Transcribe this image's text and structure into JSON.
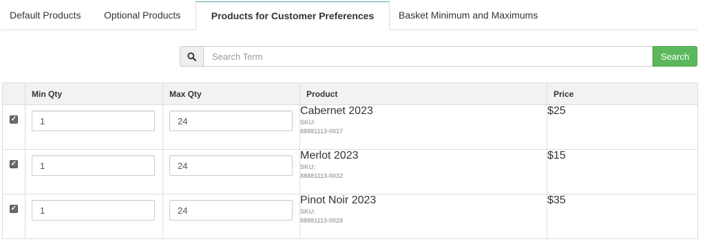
{
  "tabs": [
    {
      "label": "Default Products",
      "active": false
    },
    {
      "label": "Optional Products",
      "active": false
    },
    {
      "label": "Products for Customer Preferences",
      "active": true
    },
    {
      "label": "Basket Minimum and Maximums",
      "active": false
    }
  ],
  "search": {
    "placeholder": "Search Term",
    "value": "",
    "button_label": "Search",
    "icon": "search-icon"
  },
  "table": {
    "headers": [
      "",
      "Min Qty",
      "Max Qty",
      "Product",
      "Price"
    ],
    "rows": [
      {
        "checked": true,
        "min_qty": "1",
        "max_qty": "24",
        "product": "Cabernet 2023",
        "sku_label": "SKU:",
        "sku": "88881113-0017",
        "price": "$25"
      },
      {
        "checked": true,
        "min_qty": "1",
        "max_qty": "24",
        "product": "Merlot 2023",
        "sku_label": "SKU:",
        "sku": "88881113-0032",
        "price": "$15"
      },
      {
        "checked": true,
        "min_qty": "1",
        "max_qty": "24",
        "product": "Pinot Noir 2023",
        "sku_label": "SKU:",
        "sku": "88881113-0028",
        "price": "$35"
      }
    ]
  },
  "colors": {
    "accent": "#4aa7a0",
    "search_button": "#5cb85c",
    "header_bg": "#f2f2f2",
    "border": "#dddddd",
    "muted_text": "#aaaaaa"
  }
}
